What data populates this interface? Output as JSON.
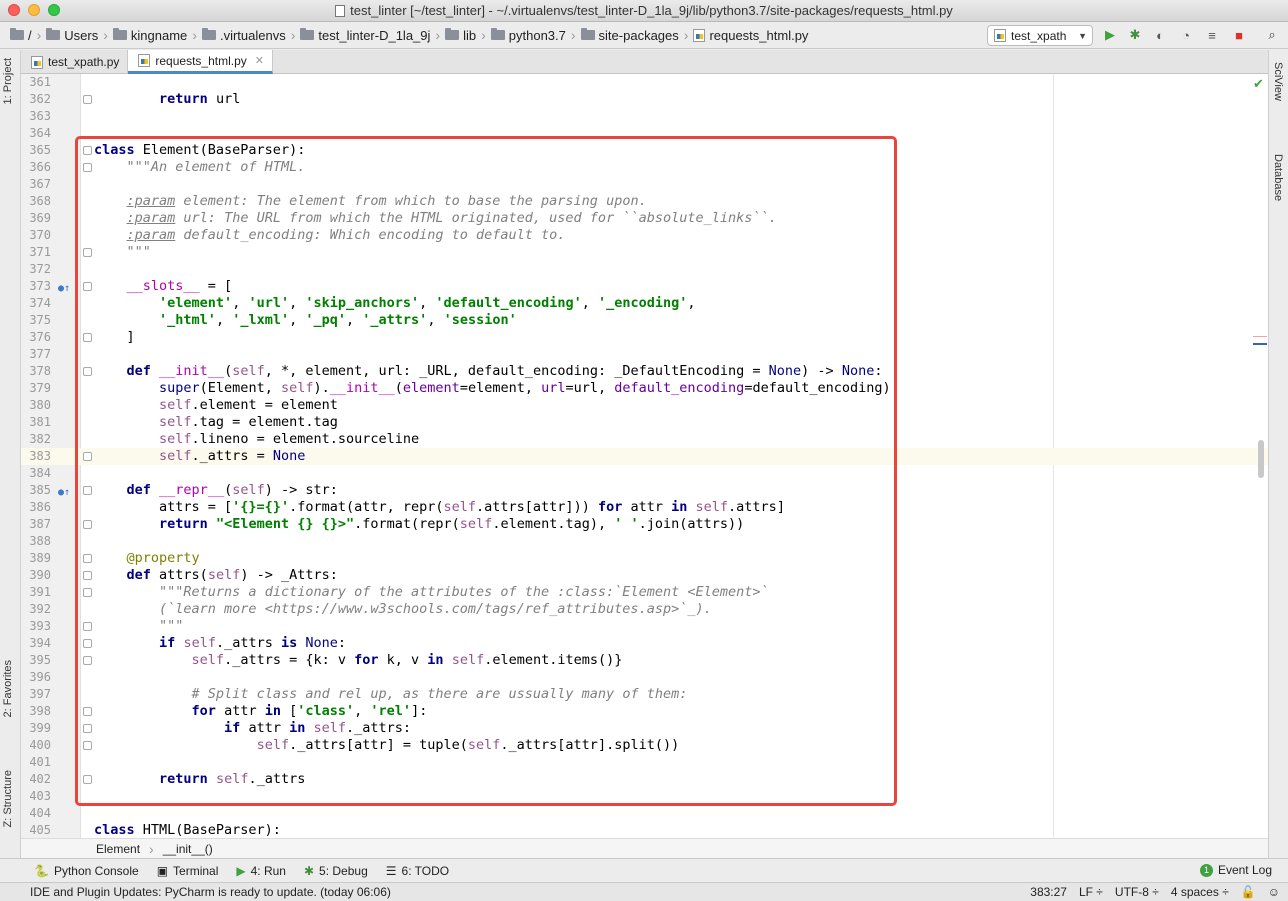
{
  "window": {
    "title": "test_linter [~/test_linter] - ~/.virtualenvs/test_linter-D_1la_9j/lib/python3.7/site-packages/requests_html.py"
  },
  "navbar": {
    "crumbs": [
      "/",
      "Users",
      "kingname",
      ".virtualenvs",
      "test_linter-D_1la_9j",
      "lib",
      "python3.7",
      "site-packages",
      "requests_html.py"
    ],
    "run_config": "test_xpath"
  },
  "tabs": [
    {
      "label": "test_xpath.py",
      "active": false
    },
    {
      "label": "requests_html.py",
      "active": true
    }
  ],
  "left_tools": {
    "project": "1: Project",
    "favorites": "2: Favorites",
    "structure": "Z: Structure"
  },
  "right_tools": {
    "sciview": "SciView",
    "database": "Database"
  },
  "editor": {
    "current_line": 383,
    "lines": [
      {
        "n": "361",
        "html": ""
      },
      {
        "n": "362",
        "html": "        <span class='kw'>return</span> url"
      },
      {
        "n": "363",
        "html": ""
      },
      {
        "n": "364",
        "html": ""
      },
      {
        "n": "365",
        "html": "<span class='kw'>class</span> Element(BaseParser):"
      },
      {
        "n": "366",
        "html": "    <span class='doc'>\"\"\"An element of HTML.</span>"
      },
      {
        "n": "367",
        "html": ""
      },
      {
        "n": "368",
        "html": "    <span class='doc'><span class='und'>:param</span> element: The element from which to base the parsing upon.</span>"
      },
      {
        "n": "369",
        "html": "    <span class='doc'><span class='und'>:param</span> url: The URL from which the HTML originated, used for ``absolute_links``.</span>"
      },
      {
        "n": "370",
        "html": "    <span class='doc'><span class='und'>:param</span> default_encoding: Which encoding to default to.</span>"
      },
      {
        "n": "371",
        "html": "    <span class='doc'>\"\"\"</span>"
      },
      {
        "n": "372",
        "html": ""
      },
      {
        "n": "373",
        "html": "    <span class='dunder'>__slots__</span> = ["
      },
      {
        "n": "374",
        "html": "        <span class='str'>'element'</span>, <span class='str'>'url'</span>, <span class='str'>'skip_anchors'</span>, <span class='str'>'default_encoding'</span>, <span class='str'>'_encoding'</span>,"
      },
      {
        "n": "375",
        "html": "        <span class='str'>'_html'</span>, <span class='str'>'_lxml'</span>, <span class='str'>'_pq'</span>, <span class='str'>'_attrs'</span>, <span class='str'>'session'</span>"
      },
      {
        "n": "376",
        "html": "    ]"
      },
      {
        "n": "377",
        "html": ""
      },
      {
        "n": "378",
        "html": "    <span class='kw'>def</span> <span class='dunder'>__init__</span>(<span class='self'>self</span>, *, element, url: _URL, default_encoding: _DefaultEncoding = <span class='kw2'>None</span>) -> <span class='kw2'>None</span>:"
      },
      {
        "n": "379",
        "html": "        <span class='kw2'>super</span>(Element, <span class='self'>self</span>).<span class='dunder'>__init__</span>(<span class='param'>element</span>=element, <span class='param'>url</span>=url, <span class='param'>default_encoding</span>=default_encoding)"
      },
      {
        "n": "380",
        "html": "        <span class='self'>self</span>.element = element"
      },
      {
        "n": "381",
        "html": "        <span class='self'>self</span>.tag = element.tag"
      },
      {
        "n": "382",
        "html": "        <span class='self'>self</span>.lineno = element.sourceline"
      },
      {
        "n": "383",
        "html": "        <span class='self'>self</span>._attrs = <span class='kw2'>None</span>"
      },
      {
        "n": "384",
        "html": ""
      },
      {
        "n": "385",
        "html": "    <span class='kw'>def</span> <span class='dunder'>__repr__</span>(<span class='self'>self</span>) -> str:"
      },
      {
        "n": "386",
        "html": "        attrs = [<span class='str'>'{}={}'</span>.format(attr, repr(<span class='self'>self</span>.attrs[attr])) <span class='kw'>for</span> attr <span class='kw'>in</span> <span class='self'>self</span>.attrs]"
      },
      {
        "n": "387",
        "html": "        <span class='kw'>return</span> <span class='str'>\"&lt;Element {} {}&gt;\"</span>.format(repr(<span class='self'>self</span>.element.tag), <span class='str'>' '</span>.join(attrs))"
      },
      {
        "n": "388",
        "html": ""
      },
      {
        "n": "389",
        "html": "    <span class='deco'>@property</span>"
      },
      {
        "n": "390",
        "html": "    <span class='kw'>def</span> attrs(<span class='self'>self</span>) -> _Attrs:"
      },
      {
        "n": "391",
        "html": "        <span class='doc'>\"\"\"Returns a dictionary of the attributes of the :class:`Element &lt;Element&gt;`</span>"
      },
      {
        "n": "392",
        "html": "        <span class='doc'>(`learn more &lt;https://www.w3schools.com/tags/ref_attributes.asp&gt;`_).</span>"
      },
      {
        "n": "393",
        "html": "        <span class='doc'>\"\"\"</span>"
      },
      {
        "n": "394",
        "html": "        <span class='kw'>if</span> <span class='self'>self</span>._attrs <span class='kw'>is</span> <span class='kw2'>None</span>:"
      },
      {
        "n": "395",
        "html": "            <span class='self'>self</span>._attrs = {k: v <span class='kw'>for</span> k, v <span class='kw'>in</span> <span class='self'>self</span>.element.items()}"
      },
      {
        "n": "396",
        "html": ""
      },
      {
        "n": "397",
        "html": "            <span class='cmt'># Split class and rel up, as there are ussually many of them:</span>"
      },
      {
        "n": "398",
        "html": "            <span class='kw'>for</span> attr <span class='kw'>in</span> [<span class='str'>'class'</span>, <span class='str'>'rel'</span>]:"
      },
      {
        "n": "399",
        "html": "                <span class='kw'>if</span> attr <span class='kw'>in</span> <span class='self'>self</span>._attrs:"
      },
      {
        "n": "400",
        "html": "                    <span class='self'>self</span>._attrs[attr] = tuple(<span class='self'>self</span>._attrs[attr].split())"
      },
      {
        "n": "401",
        "html": ""
      },
      {
        "n": "402",
        "html": "        <span class='kw'>return</span> <span class='self'>self</span>._attrs"
      },
      {
        "n": "403",
        "html": ""
      },
      {
        "n": "404",
        "html": ""
      },
      {
        "n": "405",
        "html": "<span class='kw'>class</span> HTML(BaseParser):"
      }
    ]
  },
  "code_breadcrumb": [
    "Element",
    "__init__()"
  ],
  "tool_windows": [
    {
      "label": "Python Console",
      "icon": "python-console-icon"
    },
    {
      "label": "Terminal",
      "icon": "terminal-icon"
    },
    {
      "label": "4: Run",
      "icon": "run-icon"
    },
    {
      "label": "5: Debug",
      "icon": "debug-icon"
    },
    {
      "label": "6: TODO",
      "icon": "todo-icon"
    }
  ],
  "event_log": {
    "label": "Event Log",
    "count": "1"
  },
  "status": {
    "message": "IDE and Plugin Updates: PyCharm is ready to update. (today 06:06)",
    "position": "383:27",
    "line_sep": "LF ÷",
    "encoding": "UTF-8 ÷",
    "indent": "4 spaces ÷"
  },
  "colors": {
    "highlight_box": "#e8463c",
    "accent": "#4a88c7"
  }
}
